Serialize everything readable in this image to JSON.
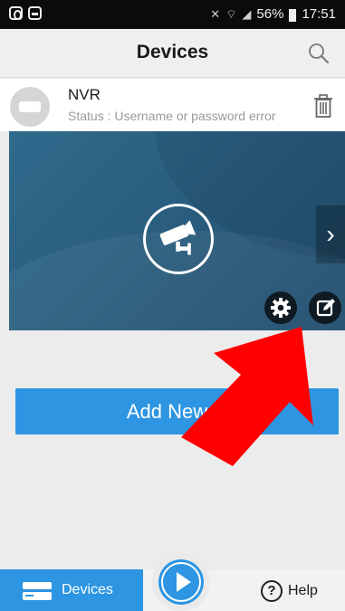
{
  "status_bar": {
    "battery": "56%",
    "time": "17:51",
    "icons": [
      "skype-icon",
      "screenshot-icon",
      "mute-icon",
      "wifi-icon",
      "signal-icon",
      "battery-icon"
    ]
  },
  "header": {
    "title": "Devices",
    "search_icon": "search-icon"
  },
  "device": {
    "name": "NVR",
    "status": "Status : Username or password error",
    "icon": "nvr-icon",
    "delete_icon": "trash-icon"
  },
  "preview": {
    "camera_icon": "camera-icon",
    "next_icon": "chevron-right-icon",
    "next_glyph": "›",
    "settings_icon": "gear-icon",
    "edit_icon": "edit-icon"
  },
  "add_button": {
    "label": "Add New Device",
    "visible_label": "Add New D"
  },
  "bottom_nav": {
    "devices_label": "Devices",
    "help_label": "Help",
    "help_glyph": "?",
    "play_icon": "play-icon"
  },
  "colors": {
    "accent": "#2d95e2",
    "annotation_arrow": "#ff0000",
    "preview_bg": "#2b5f80"
  }
}
